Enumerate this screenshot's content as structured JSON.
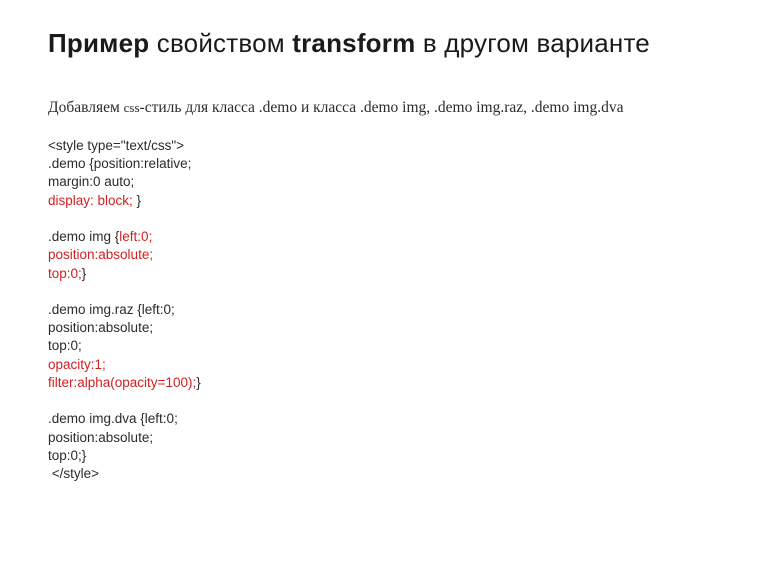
{
  "title": {
    "part1_bold": "Пример",
    "part2": " свойством ",
    "part3_bold": "transform",
    "part4": " в другом варианте"
  },
  "intro": {
    "t1": "Добавляем ",
    "t2_small": "css",
    "t3": "-стиль для класса .demo и класса .demo img, .demo img.raz, .demo img.dva"
  },
  "code": {
    "l01": "<style type=\"text/css\">",
    "l02": ".demo {position:relative;",
    "l03": "margin:0 auto;",
    "l04_red": "display: block;",
    "l04b": " }",
    "blank1": "",
    "l05a": ".demo img {",
    "l05b_red": "left:0;",
    "l06_red": "position:absolute;",
    "l07_red": "top:0;",
    "l07b": "}",
    "blank2": "",
    "l08": ".demo img.raz {left:0;",
    "l09": "position:absolute;",
    "l10": "top:0;",
    "l11_red": "opacity:1;",
    "l12_red": "filter:alpha(opacity=100);",
    "l12b": "}",
    "blank3": "",
    "l13": ".demo img.dva {left:0;",
    "l14": "position:absolute;",
    "l15": "top:0;}",
    "l16": " </style>"
  }
}
